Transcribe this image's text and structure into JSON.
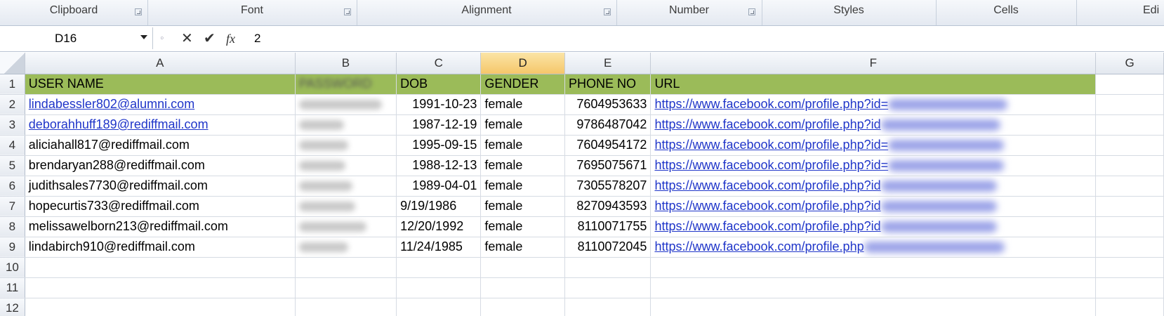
{
  "ribbon": {
    "groups": [
      {
        "label": "Clipboard"
      },
      {
        "label": "Font"
      },
      {
        "label": "Alignment"
      },
      {
        "label": "Number"
      },
      {
        "label": "Styles"
      },
      {
        "label": "Cells"
      },
      {
        "label": "Edi"
      }
    ]
  },
  "formula_bar": {
    "name_box": "D16",
    "value": "2",
    "cancel_icon": "✕",
    "enter_icon": "✔",
    "fx_label": "fx"
  },
  "columns": [
    "A",
    "B",
    "C",
    "D",
    "E",
    "F",
    "G"
  ],
  "active_column": "D",
  "header_row": {
    "row_number": "1",
    "cells": [
      "USER NAME",
      "PASSWORD",
      "DOB",
      "GENDER",
      "PHONE NO",
      "URL"
    ]
  },
  "rows": [
    {
      "n": "2",
      "user": "lindabessler802@alumni.com",
      "user_link": true,
      "dob": "1991-10-23",
      "gender": "female",
      "phone": "7604953633",
      "url": "https://www.facebook.com/profile.php?id="
    },
    {
      "n": "3",
      "user": "deborahhuff189@rediffmail.com",
      "user_link": true,
      "dob": "1987-12-19",
      "gender": "female",
      "phone": "9786487042",
      "url": "https://www.facebook.com/profile.php?id"
    },
    {
      "n": "4",
      "user": "aliciahall817@rediffmail.com",
      "user_link": false,
      "dob": "1995-09-15",
      "gender": "female",
      "phone": "7604954172",
      "url": "https://www.facebook.com/profile.php?id="
    },
    {
      "n": "5",
      "user": "brendaryan288@rediffmail.com",
      "user_link": false,
      "dob": "1988-12-13",
      "gender": "female",
      "phone": "7695075671",
      "url": "https://www.facebook.com/profile.php?id="
    },
    {
      "n": "6",
      "user": "judithsales7730@rediffmail.com",
      "user_link": false,
      "dob": "1989-04-01",
      "gender": "female",
      "phone": "7305578207",
      "url": "https://www.facebook.com/profile.php?id"
    },
    {
      "n": "7",
      "user": "hopecurtis733@rediffmail.com",
      "user_link": false,
      "dob": "9/19/1986",
      "gender": "female",
      "phone": "8270943593",
      "url": "https://www.facebook.com/profile.php?id"
    },
    {
      "n": "8",
      "user": "melissawelborn213@rediffmail.com",
      "user_link": false,
      "dob": "12/20/1992",
      "gender": "female",
      "phone": "8110071755",
      "url": "https://www.facebook.com/profile.php?id"
    },
    {
      "n": "9",
      "user": "lindabirch910@rediffmail.com",
      "user_link": false,
      "dob": "11/24/1985",
      "gender": "female",
      "phone": "8110072045",
      "url": "https://www.facebook.com/profile.php"
    }
  ],
  "empty_rows": [
    "10",
    "11",
    "12"
  ],
  "colors": {
    "header_fill": "#9bbb59",
    "link": "#1f35c9",
    "active_header": "#f5c66a"
  }
}
